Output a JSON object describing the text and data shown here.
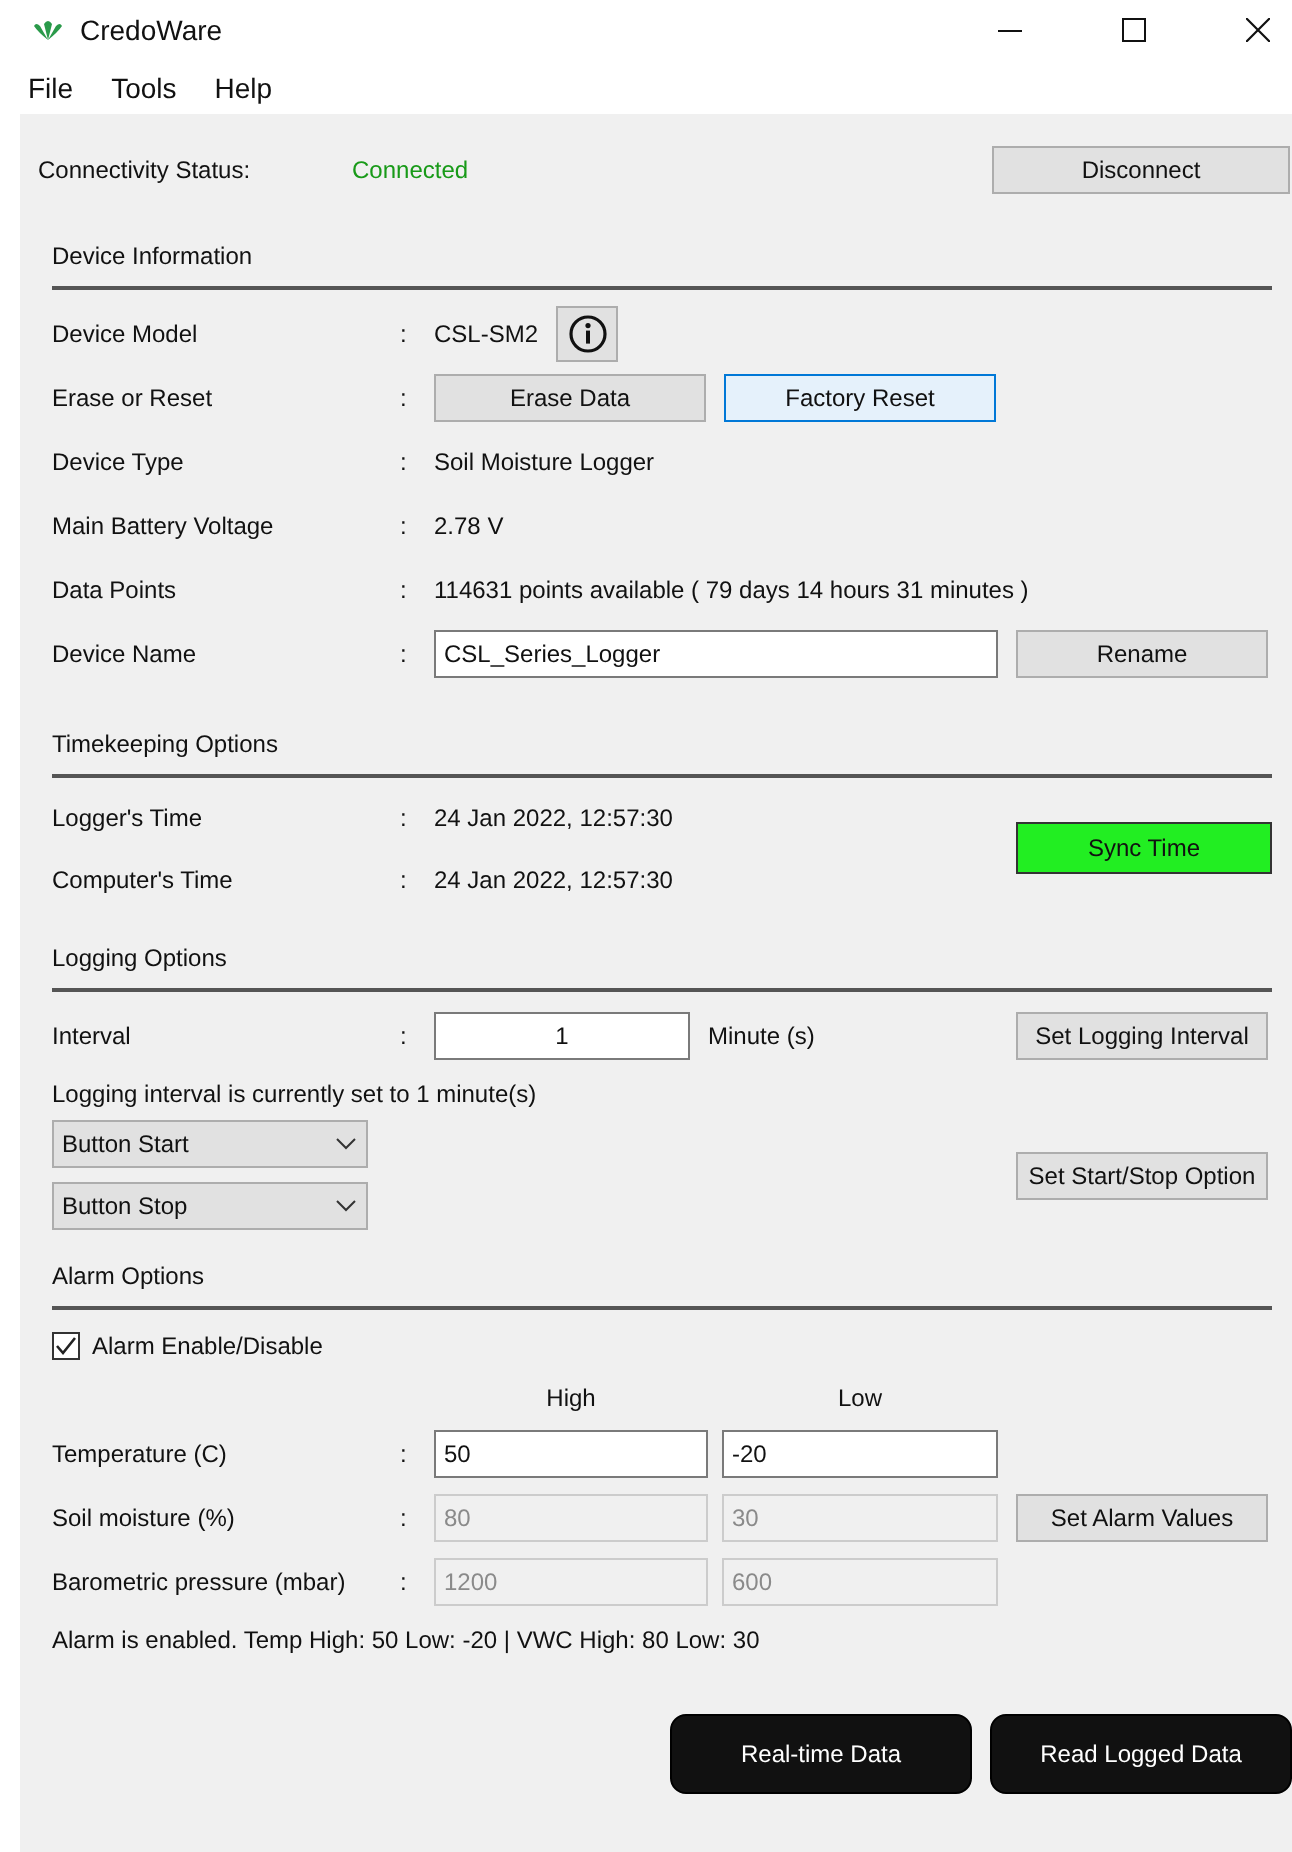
{
  "window": {
    "title": "CredoWare"
  },
  "menu": [
    "File",
    "Tools",
    "Help"
  ],
  "connectivity": {
    "label": "Connectivity Status:",
    "status": "Connected",
    "connected": true,
    "button": "Disconnect"
  },
  "device_information": {
    "title": "Device Information",
    "rows": [
      {
        "kind": "model",
        "label": "Device Model",
        "separator": ":",
        "value": "CSL-SM2"
      },
      {
        "kind": "buttons",
        "label": "Erase or Reset",
        "separator": ":",
        "buttons": [
          {
            "label": "Erase Data",
            "focused": false
          },
          {
            "label": "Factory Reset",
            "focused": true
          }
        ]
      },
      {
        "kind": "text",
        "label": "Device Type",
        "separator": ":",
        "value": "Soil Moisture Logger"
      },
      {
        "kind": "text",
        "label": "Main Battery Voltage",
        "separator": ":",
        "value": "2.78 V"
      },
      {
        "kind": "text",
        "label": "Data Points",
        "separator": ":",
        "value": "114631 points available ( 79 days 14 hours 31 minutes )"
      },
      {
        "kind": "field",
        "label": "Device Name",
        "separator": ":",
        "value": "CSL_Series_Logger",
        "button": "Rename"
      }
    ]
  },
  "timekeeping": {
    "title": "Timekeeping Options",
    "rows": [
      {
        "label": "Logger's Time",
        "separator": ":",
        "value": "24 Jan 2022, 12:57:30"
      },
      {
        "label": "Computer's Time",
        "separator": ":",
        "value": "24 Jan 2022, 12:57:30"
      }
    ],
    "button": "Sync Time"
  },
  "logging": {
    "title": "Logging Options",
    "interval": {
      "label": "Interval",
      "separator": ":",
      "value": "1",
      "unit": "Minute (s)",
      "button": "Set Logging Interval"
    },
    "status_text": "Logging interval is currently set to 1 minute(s)",
    "start_select": "Button Start",
    "stop_select": "Button Stop",
    "button": "Set Start/Stop Option"
  },
  "alarm": {
    "title": "Alarm Options",
    "enable": {
      "label": "Alarm Enable/Disable",
      "checked": true
    },
    "columns": [
      "High",
      "Low"
    ],
    "rows": [
      {
        "label": "Temperature (C)",
        "separator": ":",
        "high": "50",
        "low": "-20",
        "disabled": false
      },
      {
        "label": "Soil moisture (%)",
        "separator": ":",
        "high": "80",
        "low": "30",
        "disabled": true
      },
      {
        "label": "Barometric pressure (mbar)",
        "separator": ":",
        "high": "1200",
        "low": "600",
        "disabled": true
      }
    ],
    "button": "Set Alarm Values",
    "status_text": "Alarm is enabled. Temp High: 50 Low: -20 | VWC High: 80 Low: 30"
  },
  "footer_buttons": [
    "Real-time Data",
    "Read Logged Data"
  ]
}
